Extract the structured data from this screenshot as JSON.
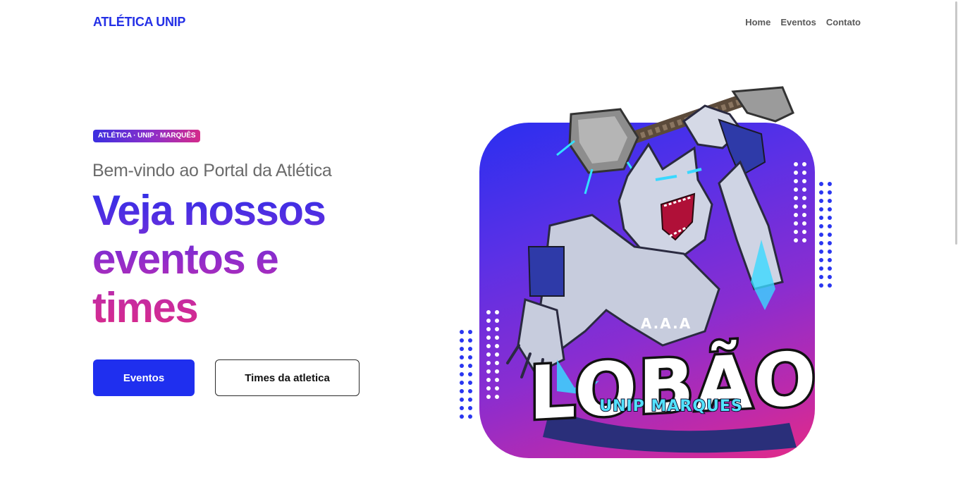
{
  "navbar": {
    "brand": "ATLÉTICA UNIP",
    "links": [
      "Home",
      "Eventos",
      "Contato"
    ]
  },
  "hero": {
    "badge": "ATLÉTICA · UNIP · MARQUÊS",
    "subtitle": "Bem-vindo ao Portal da Atlética",
    "headline_lines": [
      "Veja nossos",
      "eventos e",
      "times"
    ],
    "primary_button": "Eventos",
    "secondary_button": "Times da atletica"
  },
  "mascot": {
    "top_text": "A.A.A",
    "logo_text": "LOBÃO",
    "sub_text": "UNIP MARQUES"
  },
  "colors": {
    "brand": "#2430e6",
    "primary_button": "#1f2fef",
    "gradient_start": "#2a2ff0",
    "gradient_end": "#e42a86"
  },
  "icons": [
    "wolf-mascot-logo",
    "hammer-icon"
  ]
}
